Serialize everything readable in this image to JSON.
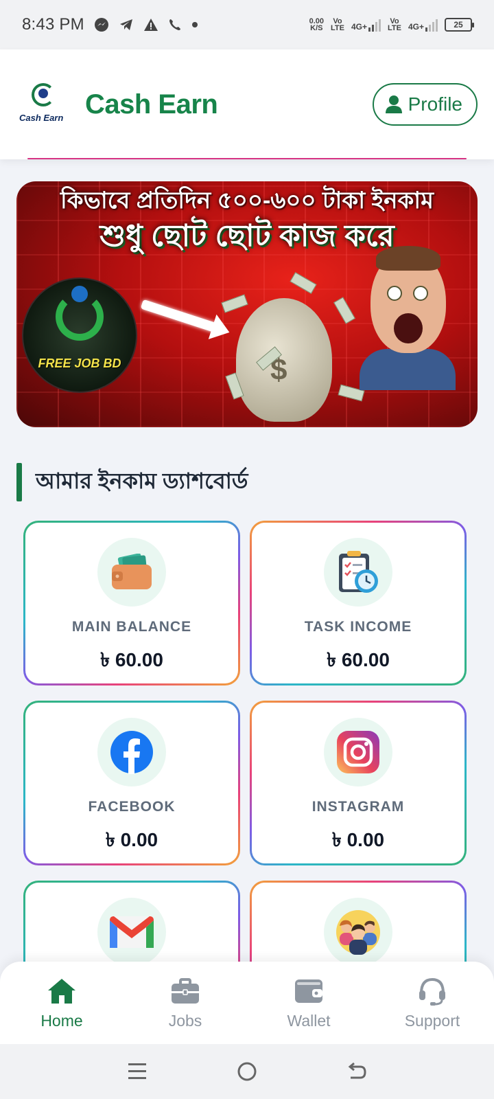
{
  "status_bar": {
    "time": "8:43 PM",
    "net_speed_value": "0.00",
    "net_speed_unit": "K/S",
    "sim1_label_top": "Vo",
    "sim1_label_bottom": "LTE",
    "sim1_net": "4G+",
    "sim2_label_top": "Vo",
    "sim2_label_bottom": "LTE",
    "sim2_net": "4G+",
    "battery": "25",
    "icons": [
      "messenger-icon",
      "telegram-icon",
      "warning-icon",
      "wifi-call-icon",
      "dot-icon"
    ]
  },
  "header": {
    "logo_text": "Cash Earn",
    "app_title": "Cash Earn",
    "profile_label": "Profile"
  },
  "banner": {
    "line1": "কিভাবে প্রতিদিন ৫০০-৬০০ টাকা ইনকাম",
    "line2": "শুধু ছোট ছোট কাজ করে",
    "logo_text": "FREE JOB BD",
    "bag_symbol": "$"
  },
  "dashboard": {
    "title": "আমার ইনকাম ড্যাশবোর্ড",
    "cards": [
      {
        "label": "MAIN BALANCE",
        "value": "৳ 60.00",
        "icon": "wallet-icon"
      },
      {
        "label": "TASK INCOME",
        "value": "৳ 60.00",
        "icon": "clipboard-clock-icon"
      },
      {
        "label": "FACEBOOK",
        "value": "৳ 0.00",
        "icon": "facebook-icon"
      },
      {
        "label": "INSTAGRAM",
        "value": "৳ 0.00",
        "icon": "instagram-icon"
      },
      {
        "label": "",
        "value": "",
        "icon": "gmail-icon"
      },
      {
        "label": "",
        "value": "",
        "icon": "team-icon"
      }
    ]
  },
  "bottom_nav": {
    "items": [
      {
        "label": "Home",
        "icon": "home-icon",
        "active": true
      },
      {
        "label": "Jobs",
        "icon": "briefcase-icon",
        "active": false
      },
      {
        "label": "Wallet",
        "icon": "wallet-icon",
        "active": false
      },
      {
        "label": "Support",
        "icon": "headset-icon",
        "active": false
      }
    ]
  },
  "colors": {
    "brand_green": "#1a7a47",
    "inactive_nav": "#8e96a0",
    "accent_pink": "#d63384"
  }
}
